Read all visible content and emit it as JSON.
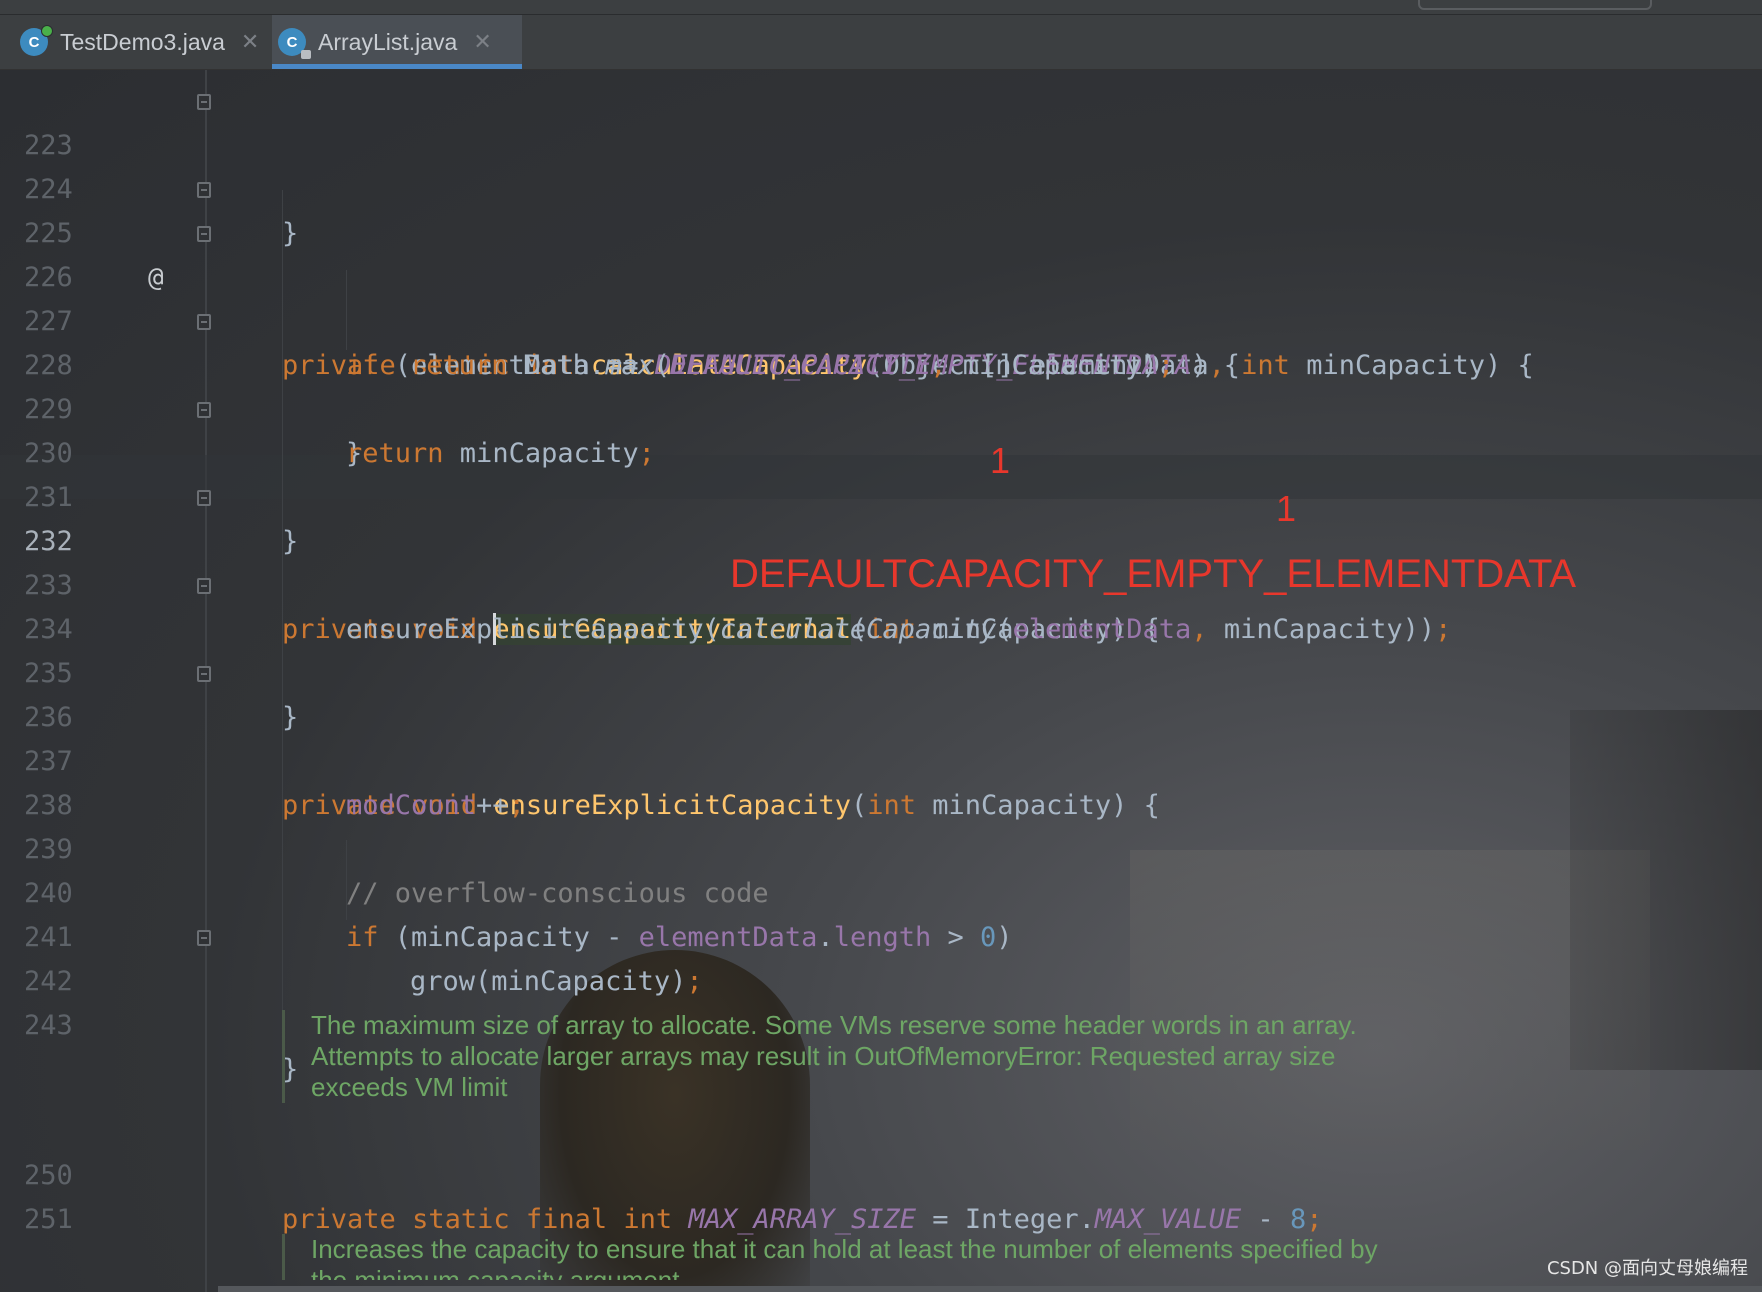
{
  "tabs": [
    {
      "label": "TestDemo3.java",
      "icon": "class-icon",
      "close": "✕"
    },
    {
      "label": "ArrayList.java",
      "icon": "class-locked-icon",
      "close": "✕"
    }
  ],
  "lines": {
    "l223": "223",
    "l224": "224",
    "l225": "225",
    "l226": "226",
    "l227": "227",
    "l228": "228",
    "l229": "229",
    "l230": "230",
    "l231": "231",
    "l232": "232",
    "l233": "233",
    "l234": "234",
    "l235": "235",
    "l236": "236",
    "l237": "237",
    "l238": "238",
    "l239": "239",
    "l240": "240",
    "l241": "241",
    "l242": "242",
    "l243": "243",
    "l250": "250",
    "l251": "251"
  },
  "code": {
    "c223": "}",
    "c225": {
      "kw1": "private",
      "kw2": "static",
      "kw3": "int",
      "fn": "calculateCapacity",
      "p1": "(Object[] elementData",
      "comma": ",",
      "kw4": "int",
      "p2": " minCapacity) {"
    },
    "c226": {
      "kw": "if",
      "a": " (elementData == ",
      "const": "DEFAULTCAPACITY_EMPTY_ELEMENTDATA",
      "b": ") {"
    },
    "c227": {
      "kw": "return",
      "a": " Math.",
      "m": "max",
      "b": "(",
      "const": "DEFAULT_CAPACITY",
      "comma": ",",
      "c": " minCapacity)",
      "semi": ";"
    },
    "c228": "}",
    "c229": {
      "kw": "return",
      "a": " minCapacity",
      "semi": ";"
    },
    "c230": "}",
    "c232": {
      "kw1": "private",
      "kw2": "void",
      "fn": "ensureCapacityInternal",
      "a": "(",
      "kw3": "int",
      "b": " minCapacity) {"
    },
    "c233": {
      "a": "ensureExplicitCapacity(",
      "m": "calculateCapacity",
      "b": "(",
      "f": "elementData",
      "comma": ",",
      "c": " minCapacity))",
      "semi": ";"
    },
    "c234": "}",
    "c236": {
      "kw1": "private",
      "kw2": "void",
      "fn": "ensureExplicitCapacity",
      "a": "(",
      "kw3": "int",
      "b": " minCapacity) {"
    },
    "c237": {
      "f": "modCount",
      "a": "++",
      "semi": ";"
    },
    "c239": "// overflow-conscious code",
    "c240": {
      "kw": "if",
      "a": " (minCapacity - ",
      "f": "elementData",
      "b": ".",
      "f2": "length",
      "c": " > ",
      "n": "0",
      "d": ")"
    },
    "c241": {
      "a": "grow(minCapacity)",
      "semi": ";"
    },
    "c242": "}",
    "c250": {
      "kw1": "private",
      "kw2": "static",
      "kw3": "final",
      "kw4": "int",
      "const": "MAX_ARRAY_SIZE",
      "a": " = Integer.",
      "const2": "MAX_VALUE",
      "b": " - ",
      "n": "8",
      "semi": ";"
    }
  },
  "doc1": [
    "The maximum size of array to allocate. Some VMs reserve some header words in an array.",
    "Attempts to allocate larger arrays may result in OutOfMemoryError: Requested array size",
    "exceeds VM limit"
  ],
  "doc2": [
    "Increases the capacity to ensure that it can hold at least the number of elements specified by",
    "the minimum capacity argument."
  ],
  "gutter_marker": "@",
  "annotations": {
    "one_a": "1",
    "one_b": "1",
    "big": "DEFAULTCAPACITY_EMPTY_ELEMENTDATA"
  },
  "watermark": "CSDN @面向丈母娘编程",
  "colors": {
    "keyword": "#cc7832",
    "method": "#ffc66d",
    "field": "#9876aa",
    "number": "#6897bb",
    "doc": "#6ea665",
    "annotation": "#e8372c"
  }
}
